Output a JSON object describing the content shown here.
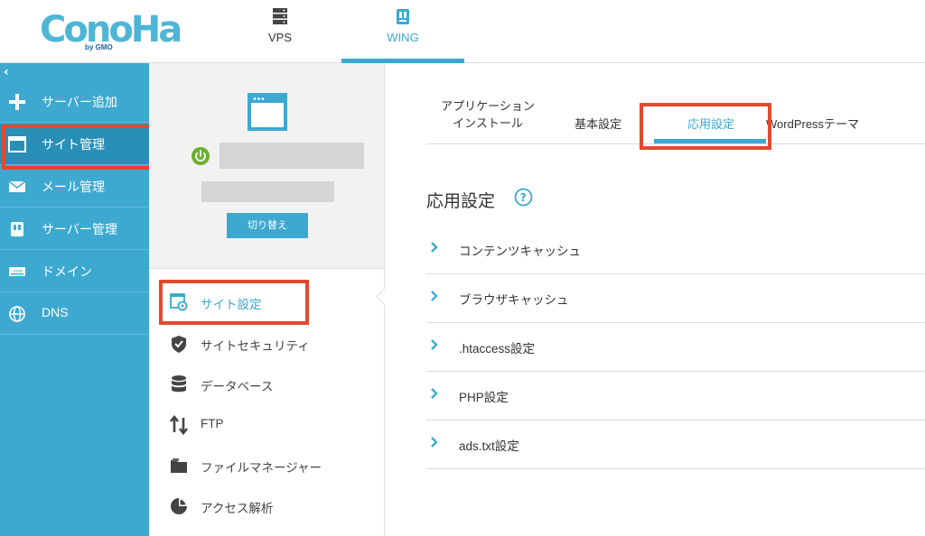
{
  "header": {
    "logo_text": "ConoHa",
    "logo_sub": "by GMO",
    "tabs": [
      {
        "label": "VPS",
        "icon": "server-icon"
      },
      {
        "label": "WING",
        "icon": "wing-icon"
      }
    ],
    "active_tab": "WING"
  },
  "sidebar": {
    "collapse_glyph": "‹",
    "items": [
      {
        "label": "サーバー追加",
        "icon": "plus-icon"
      },
      {
        "label": "サイト管理",
        "icon": "browser-window-icon"
      },
      {
        "label": "メール管理",
        "icon": "mail-icon"
      },
      {
        "label": "サーバー管理",
        "icon": "server-book-icon"
      },
      {
        "label": "ドメイン",
        "icon": "domain-icon"
      },
      {
        "label": "DNS",
        "icon": "globe-icon"
      }
    ],
    "active_item": "サイト管理"
  },
  "site_panel": {
    "switch_label": "切り替え",
    "menu": [
      {
        "label": "サイト設定",
        "icon": "site-settings-icon"
      },
      {
        "label": "サイトセキュリティ",
        "icon": "shield-check-icon"
      },
      {
        "label": "データベース",
        "icon": "database-icon"
      },
      {
        "label": "FTP",
        "icon": "transfer-arrows-icon"
      },
      {
        "label": "ファイルマネージャー",
        "icon": "folder-icon"
      },
      {
        "label": "アクセス解析",
        "icon": "pie-chart-icon"
      }
    ],
    "active_menu": "サイト設定"
  },
  "main": {
    "subtabs": [
      {
        "line1": "アプリケーション",
        "line2": "インストール"
      },
      {
        "line1": "基本設定",
        "line2": ""
      },
      {
        "line1": "応用設定",
        "line2": ""
      },
      {
        "line1": "WordPressテーマ",
        "line2": ""
      }
    ],
    "active_subtab": "応用設定",
    "section_title": "応用設定",
    "accordion": [
      {
        "label": "コンテンツキャッシュ"
      },
      {
        "label": "ブラウザキャッシュ"
      },
      {
        "label": ".htaccess設定"
      },
      {
        "label": "PHP設定"
      },
      {
        "label": "ads.txt設定"
      }
    ]
  },
  "colors": {
    "accent": "#3ea9d0",
    "sidebar_active": "#2a8fb6",
    "highlight_box": "#e2492f",
    "power_green": "#6ab02f"
  }
}
